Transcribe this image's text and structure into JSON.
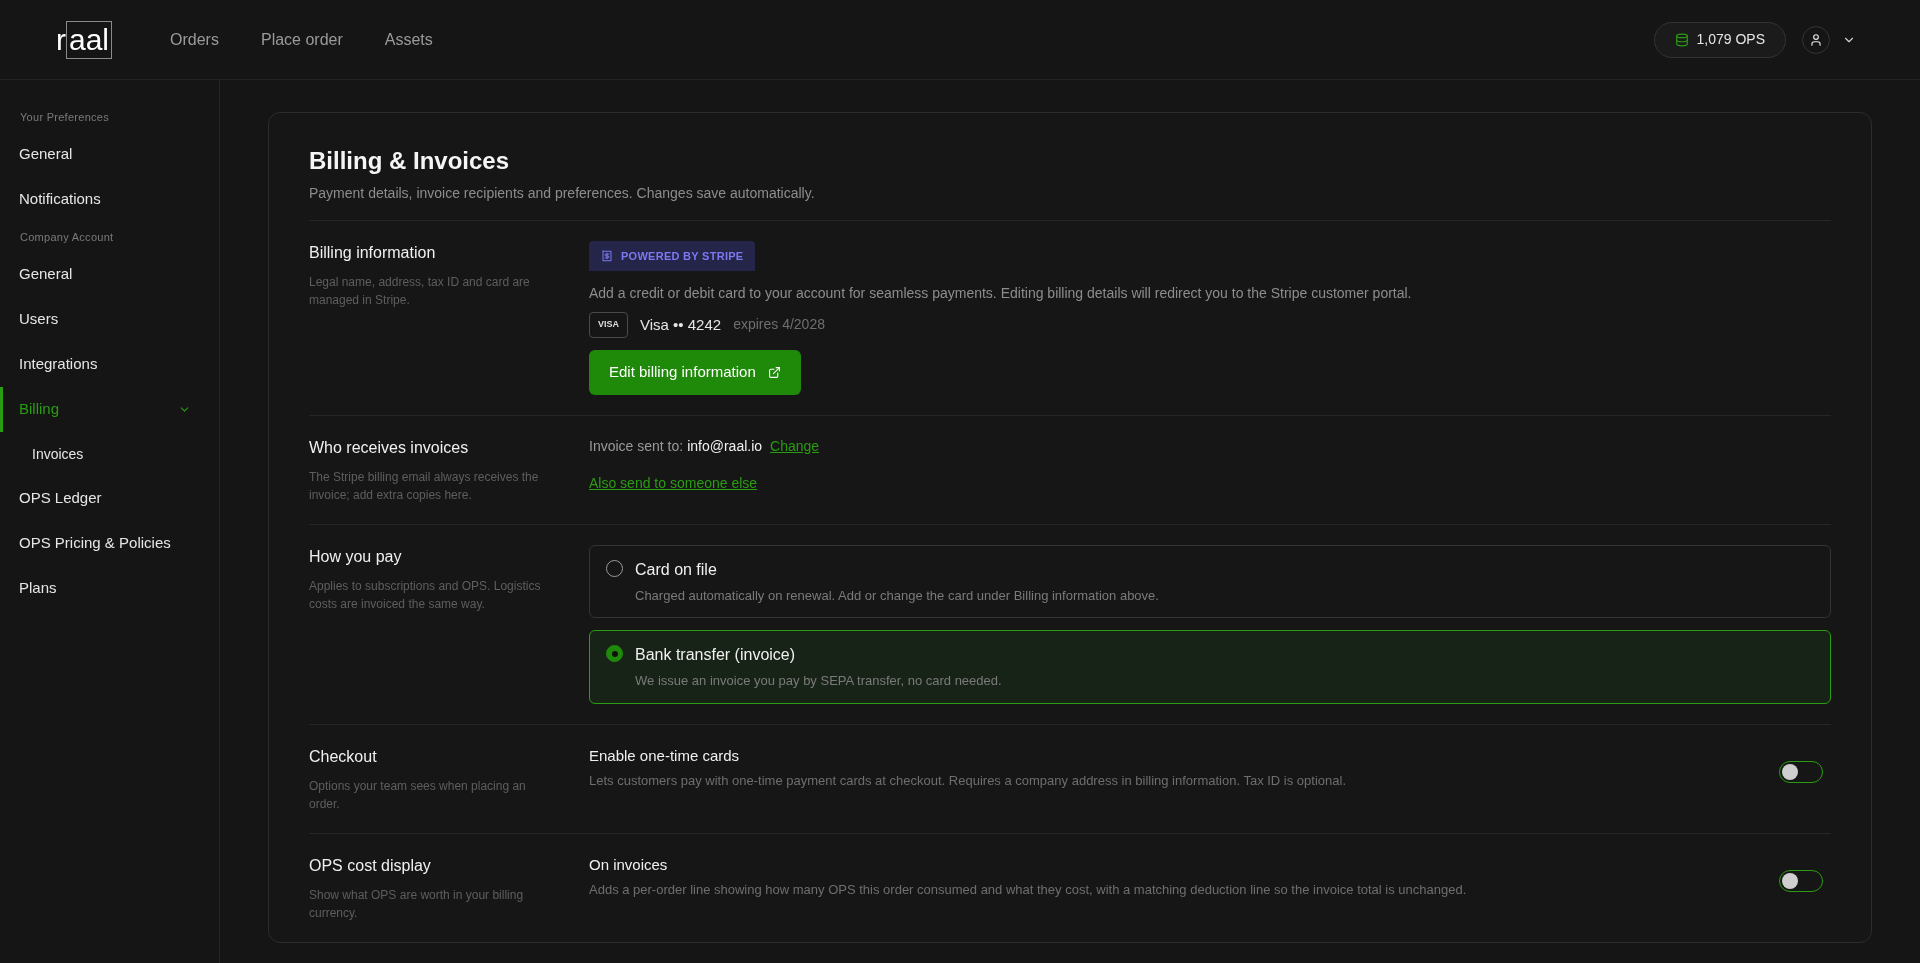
{
  "header": {
    "logo": "raal",
    "nav": [
      "Orders",
      "Place order",
      "Assets"
    ],
    "balance": "1,079 OPS"
  },
  "sidebar": {
    "sections": [
      {
        "heading": "Your Preferences",
        "items": [
          {
            "label": "General",
            "selected": false
          },
          {
            "label": "Notifications",
            "selected": false
          }
        ]
      },
      {
        "heading": "Company Account",
        "items": [
          {
            "label": "General",
            "selected": false
          },
          {
            "label": "Users",
            "selected": false
          },
          {
            "label": "Integrations",
            "selected": false
          },
          {
            "label": "Billing",
            "selected": true,
            "expanded": true,
            "children": [
              {
                "label": "Invoices",
                "selected": false
              }
            ]
          },
          {
            "label": "OPS Ledger",
            "selected": false
          },
          {
            "label": "OPS Pricing & Policies",
            "selected": false
          },
          {
            "label": "Plans",
            "selected": false
          }
        ]
      }
    ]
  },
  "page": {
    "title": "Billing & Invoices",
    "subtitle": "Payment details, invoice recipients and preferences. Changes save automatically."
  },
  "sections": [
    {
      "kind": "billing",
      "title": "Billing information",
      "description": "Legal name, address, tax ID and card are managed in Stripe.",
      "badge": "POWERED BY STRIPE",
      "text": "Add a credit or debit card to your account for seamless payments. Editing billing details will redirect you to the Stripe customer portal.",
      "card": {
        "brand": "VISA",
        "label": "Visa •• 4242",
        "expiry": "expires 4/2028"
      },
      "button": "Edit billing information"
    },
    {
      "kind": "recipients",
      "title": "Who receives invoices",
      "description": "The Stripe billing email always receives the invoice; add extra copies here.",
      "sent_label": "Invoice sent to:",
      "email": "info@raal.io",
      "change_link": "Change",
      "add_link": "Also send to someone else"
    },
    {
      "kind": "payment",
      "title": "How you pay",
      "description": "Applies to subscriptions and OPS. Logistics costs are invoiced the same way.",
      "options": [
        {
          "label": "Card on file",
          "description": "Charged automatically on renewal. Add or change the card under Billing information above.",
          "selected": false
        },
        {
          "label": "Bank transfer (invoice)",
          "description": "We issue an invoice you pay by SEPA transfer, no card needed.",
          "selected": true
        }
      ]
    },
    {
      "kind": "toggle",
      "title": "Checkout",
      "description": "Options your team sees when placing an order.",
      "setting": {
        "label": "Enable one-time cards",
        "description": "Lets customers pay with one-time payment cards at checkout. Requires a company address in billing information. Tax ID is optional.",
        "on": false
      }
    },
    {
      "kind": "toggle",
      "title": "OPS cost display",
      "description": "Show what OPS are worth in your billing currency.",
      "setting": {
        "label": "On invoices",
        "description": "Adds a per-order line showing how many OPS this order consumed and what they cost, with a matching deduction line so the invoice total is unchanged.",
        "on": false
      }
    }
  ]
}
